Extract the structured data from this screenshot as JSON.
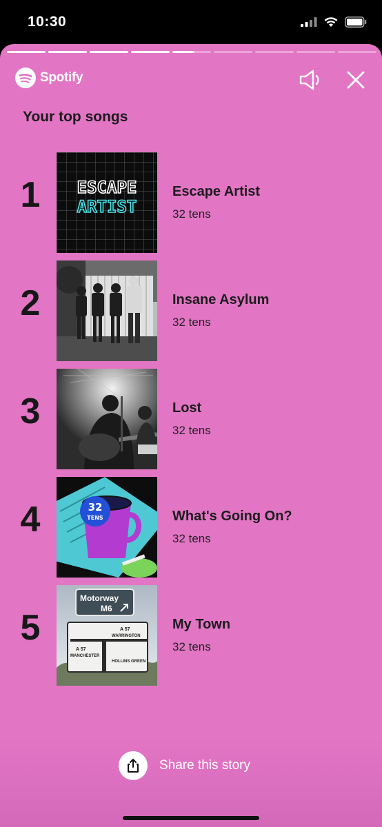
{
  "status_bar": {
    "time": "10:30"
  },
  "story": {
    "progress": [
      1,
      1,
      1,
      1,
      0.55,
      0,
      0,
      0,
      0
    ],
    "brand": "Spotify",
    "heading": "Your top songs",
    "share_label": "Share this story",
    "colors": {
      "background": "#e375c5",
      "text": "#1c1c1c"
    }
  },
  "songs": [
    {
      "rank": "1",
      "title": "Escape Artist",
      "artist": "32 tens",
      "cover_line1": "ESCAPE",
      "cover_line2": "ARTIST"
    },
    {
      "rank": "2",
      "title": "Insane Asylum",
      "artist": "32 tens"
    },
    {
      "rank": "3",
      "title": "Lost",
      "artist": "32 tens"
    },
    {
      "rank": "4",
      "title": "What's Going On?",
      "artist": "32 tens",
      "cover_mug_num": "32",
      "cover_mug_word": "TENS"
    },
    {
      "rank": "5",
      "title": "My Town",
      "artist": "32 tens",
      "cover_sign1": "Motorway",
      "cover_sign2": "M6",
      "cover_board_a1": "A 57",
      "cover_board_place1": "WARRINGTON",
      "cover_board_a2": "A 57",
      "cover_board_place2": "MANCHESTER",
      "cover_board_place3": "HOLLINS GREEN"
    }
  ]
}
